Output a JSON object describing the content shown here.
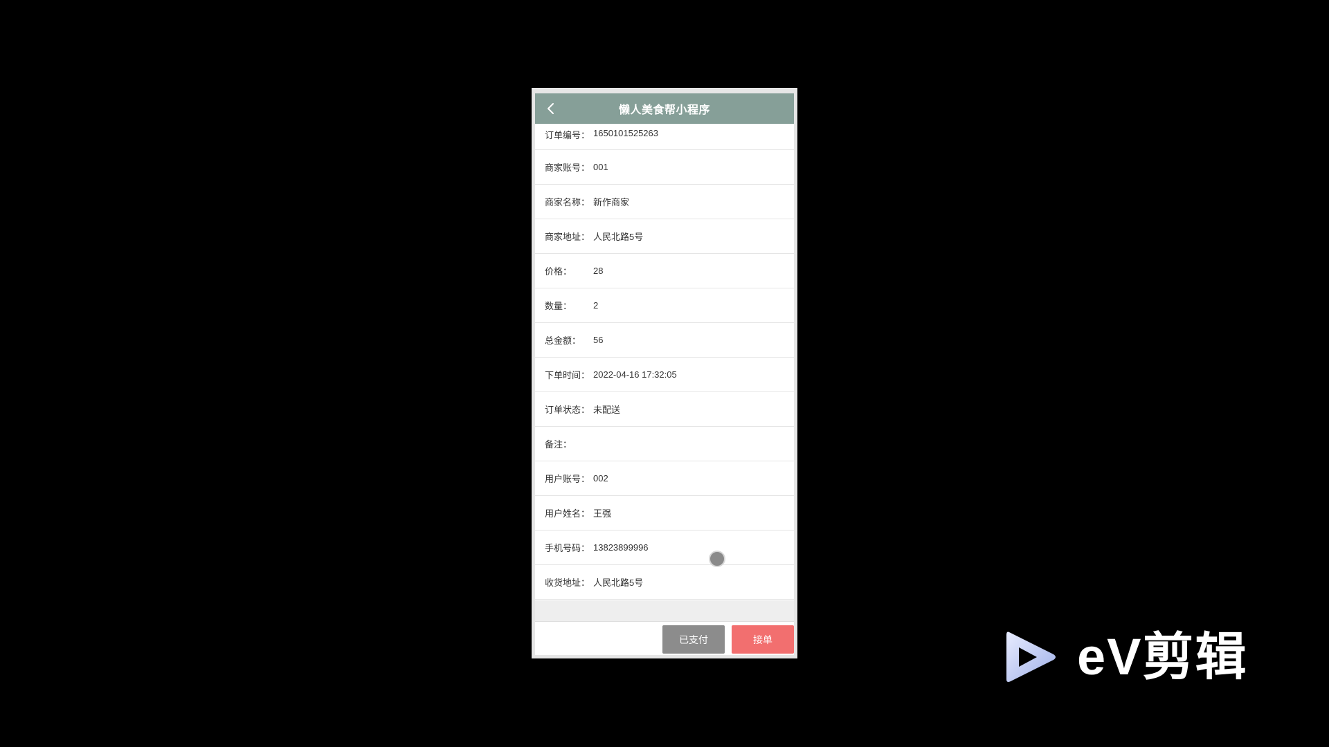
{
  "app": {
    "title": "懒人美食帮小程序"
  },
  "order": {
    "rows": [
      {
        "label": "订单编号：",
        "value": "1650101525263"
      },
      {
        "label": "商家账号：",
        "value": "001"
      },
      {
        "label": "商家名称：",
        "value": "新作商家"
      },
      {
        "label": "商家地址：",
        "value": "人民北路5号"
      },
      {
        "label": "价格：",
        "value": "28"
      },
      {
        "label": "数量：",
        "value": "2"
      },
      {
        "label": "总金额：",
        "value": "56"
      },
      {
        "label": "下单时间：",
        "value": "2022-04-16 17:32:05"
      },
      {
        "label": "订单状态：",
        "value": "未配送"
      },
      {
        "label": "备注：",
        "value": ""
      },
      {
        "label": "用户账号：",
        "value": "002"
      },
      {
        "label": "用户姓名：",
        "value": "王强"
      },
      {
        "label": "手机号码：",
        "value": "13823899996"
      },
      {
        "label": "收货地址：",
        "value": "人民北路5号"
      }
    ]
  },
  "footer": {
    "paid_label": "已支付",
    "accept_label": "接单"
  },
  "watermark": {
    "text": "eV剪辑",
    "icon": "play-logo-icon"
  },
  "colors": {
    "nav": "#869f98",
    "paid_button": "#8c8c8c",
    "accept_button": "#f26f6f",
    "background": "#000000"
  }
}
